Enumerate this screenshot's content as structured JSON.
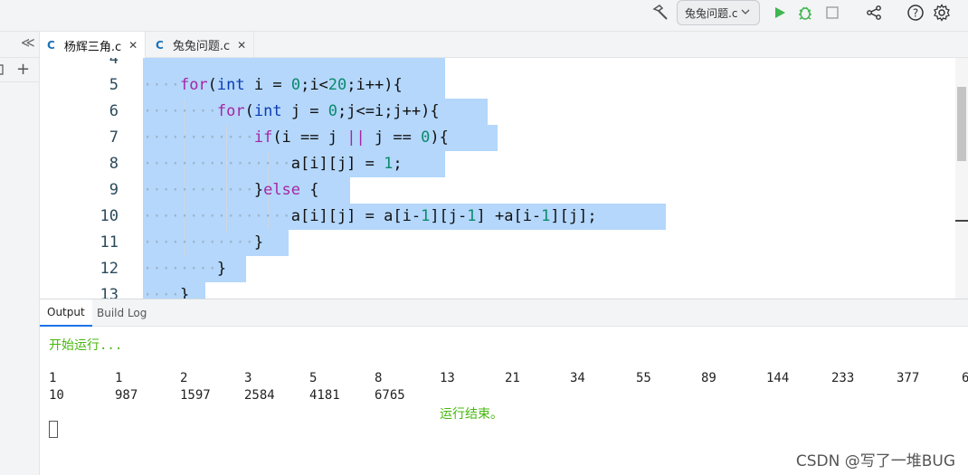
{
  "toolbar": {
    "run_config": "兔兔问题.c",
    "icons": [
      "hammer-icon",
      "chevron-down-icon",
      "run-icon",
      "debug-icon",
      "stop-icon",
      "share-icon",
      "help-icon",
      "settings-icon"
    ]
  },
  "side": {
    "collapse_glyph": "≪",
    "add_glyph": "+"
  },
  "tabs": [
    {
      "label": "杨辉三角.c",
      "lang": "C",
      "active": true
    },
    {
      "label": "兔兔问题.c",
      "lang": "C",
      "active": false
    }
  ],
  "editor": {
    "line_numbers": [
      "4",
      "5",
      "6",
      "7",
      "8",
      "9",
      "10",
      "11",
      "12",
      "13"
    ],
    "code": {
      "l5_kw": "for",
      "l5_a": "(",
      "l5_ty": "int",
      "l5_b": " i = ",
      "l5_n1": "0",
      "l5_c": ";i<",
      "l5_n2": "20",
      "l5_d": ";i++){",
      "l6_kw": "for",
      "l6_a": "(",
      "l6_ty": "int",
      "l6_b": " j = ",
      "l6_n1": "0",
      "l6_c": ";j<=i;j++){",
      "l7_kw": "if",
      "l7_a": "(i == j ",
      "l7_op": "||",
      "l7_b": " j == ",
      "l7_n1": "0",
      "l7_c": "){",
      "l8_a": "a[i][j] = ",
      "l8_n1": "1",
      "l8_b": ";",
      "l9_a": "}",
      "l9_kw": "else",
      "l9_b": " {",
      "l10_a": "a[i][j] = a[i-",
      "l10_n1": "1",
      "l10_b": "][j-",
      "l10_n2": "1",
      "l10_c": "] +a[i-",
      "l10_n3": "1",
      "l10_d": "][j];",
      "l11": "}",
      "l12": "}",
      "l13": "}"
    }
  },
  "panel": {
    "tabs": [
      "Output",
      "Build Log"
    ],
    "start_msg": "开始运行...",
    "row1": [
      "1",
      "1",
      "2",
      "3",
      "5",
      "8",
      "13",
      "21",
      "34",
      "55",
      "89",
      "144",
      "233",
      "377",
      "6"
    ],
    "row2": [
      "10",
      "987",
      "1597",
      "2584",
      "4181",
      "6765"
    ],
    "end_msg": "运行结束。",
    "watermark": "CSDN @写了一堆BUG"
  }
}
